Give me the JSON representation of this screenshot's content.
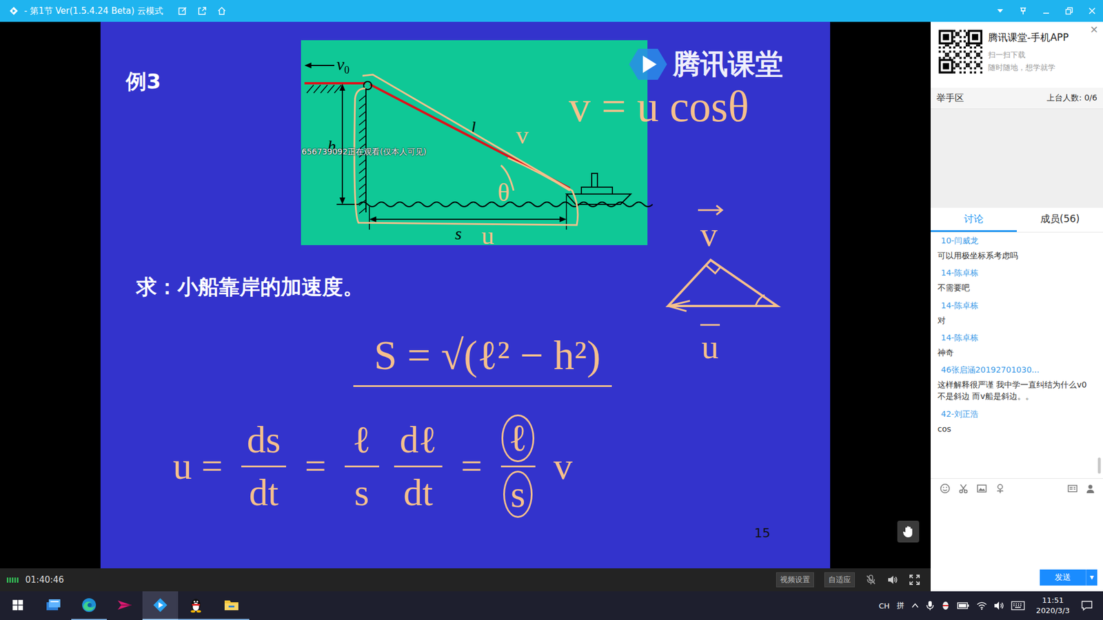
{
  "window": {
    "title": "- 第1节 Ver(1.5.4.24 Beta) 云模式"
  },
  "slide": {
    "example": "例3",
    "question": "求：小船靠岸的加速度。",
    "page": "15",
    "watermark": "656739092正在观看(仅本人可见)",
    "brand": "腾讯课堂",
    "figure": {
      "speed": "v",
      "speed_sub": "0",
      "rope": "l",
      "height": "h",
      "distance": "s",
      "rope_speed": "v",
      "angle": "θ",
      "boat_speed": "u"
    },
    "vectors": {
      "top": "v",
      "bottom": "u"
    },
    "notes": {
      "relation": "v = u cosθ",
      "distance": "S = √(ℓ² − h²)"
    },
    "derivation": [
      {
        "kind": "text",
        "text": "u =",
        "circled": false
      },
      {
        "kind": "frac",
        "num": "ds",
        "den": "dt",
        "circled": false
      },
      {
        "kind": "text",
        "text": "=",
        "circled": false
      },
      {
        "kind": "frac",
        "num": "ℓ",
        "den": "s",
        "circled": false
      },
      {
        "kind": "frac",
        "num": "dℓ",
        "den": "dt",
        "circled": false
      },
      {
        "kind": "text",
        "text": "=",
        "circled": false
      },
      {
        "kind": "frac",
        "num": "ℓ",
        "den": "s",
        "circled": true
      },
      {
        "kind": "text",
        "text": "v",
        "circled": false
      }
    ]
  },
  "player": {
    "signal": {
      "level": 1
    },
    "time": "01:40:46",
    "buttons": [
      "视频设置",
      "自适应"
    ],
    "mic_muted": true
  },
  "promo": {
    "title": "腾讯课堂-手机APP",
    "lines": [
      "扫一扫下载",
      "随时随地，想学就学"
    ],
    "close": "×"
  },
  "raise_hand": {
    "title": "举手区",
    "count": "上台人数: 0/6"
  },
  "tabs": [
    {
      "label": "讨论",
      "selected": true
    },
    {
      "label": "成员(56)",
      "selected": false
    }
  ],
  "messages": [
    {
      "name": "10-闫威龙",
      "text": "可以用极坐标系考虑吗"
    },
    {
      "name": "14-陈卓栋",
      "text": "不需要吧"
    },
    {
      "name": "14-陈卓栋",
      "text": "对"
    },
    {
      "name": "14-陈卓栋",
      "text": "神奇"
    },
    {
      "name": "46张启涵20192701030...",
      "text": "这样解释很严谨 我中学一直纠结为什么v0不是斜边 而v船是斜边。。"
    },
    {
      "name": "42-刘正浩",
      "text": "cos"
    }
  ],
  "send": {
    "label": "发送",
    "menu": "▾"
  },
  "taskbar": {
    "apps": [
      {
        "kind": "app",
        "running": false,
        "active": false
      },
      {
        "kind": "edge",
        "running": true,
        "active": false
      },
      {
        "kind": "feishu",
        "running": false,
        "active": false
      },
      {
        "kind": "classroom",
        "running": true,
        "active": true
      },
      {
        "kind": "qq",
        "running": true,
        "active": false
      },
      {
        "kind": "explorer",
        "running": true,
        "active": false
      }
    ],
    "ime": [
      "CH",
      "拼"
    ],
    "time": "11:51",
    "date": "2020/3/3"
  }
}
